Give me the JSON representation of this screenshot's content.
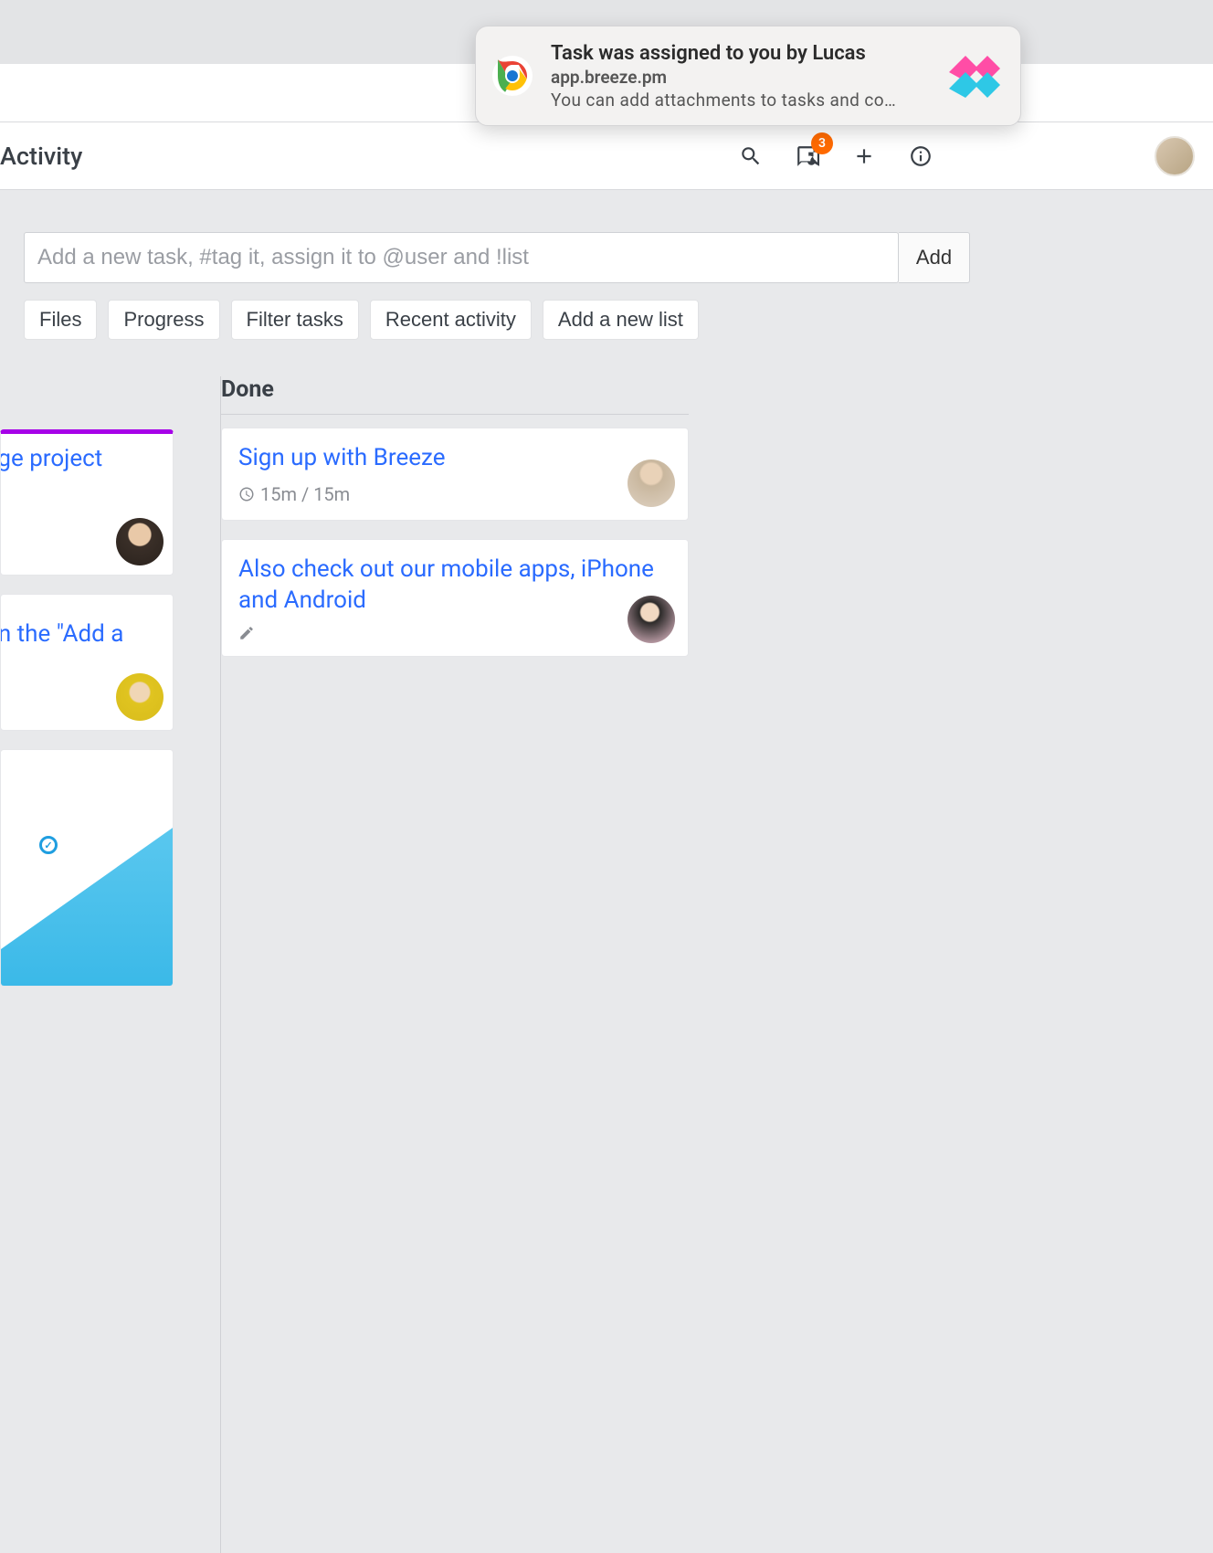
{
  "header": {
    "activity_label": "Activity",
    "badge_count": "3"
  },
  "add_task": {
    "placeholder": "Add a new task, #tag it, assign it to @user and !list",
    "button_label": "Add"
  },
  "pills": {
    "files": "Files",
    "progress": "Progress",
    "filter": "Filter tasks",
    "recent": "Recent activity",
    "add_list": "Add a new list"
  },
  "left_column": {
    "card1_title": "nge project",
    "card2_title": "on the \"Add a"
  },
  "done_column": {
    "title": "Done",
    "cards": [
      {
        "title": "Sign up with Breeze",
        "time": "15m / 15m"
      },
      {
        "title": "Also check out our mobile apps, iPhone and Android"
      }
    ]
  },
  "notification": {
    "title": "Task was assigned to you by Lucas",
    "domain": "app.breeze.pm",
    "description": "You can add attachments to tasks and co…"
  }
}
